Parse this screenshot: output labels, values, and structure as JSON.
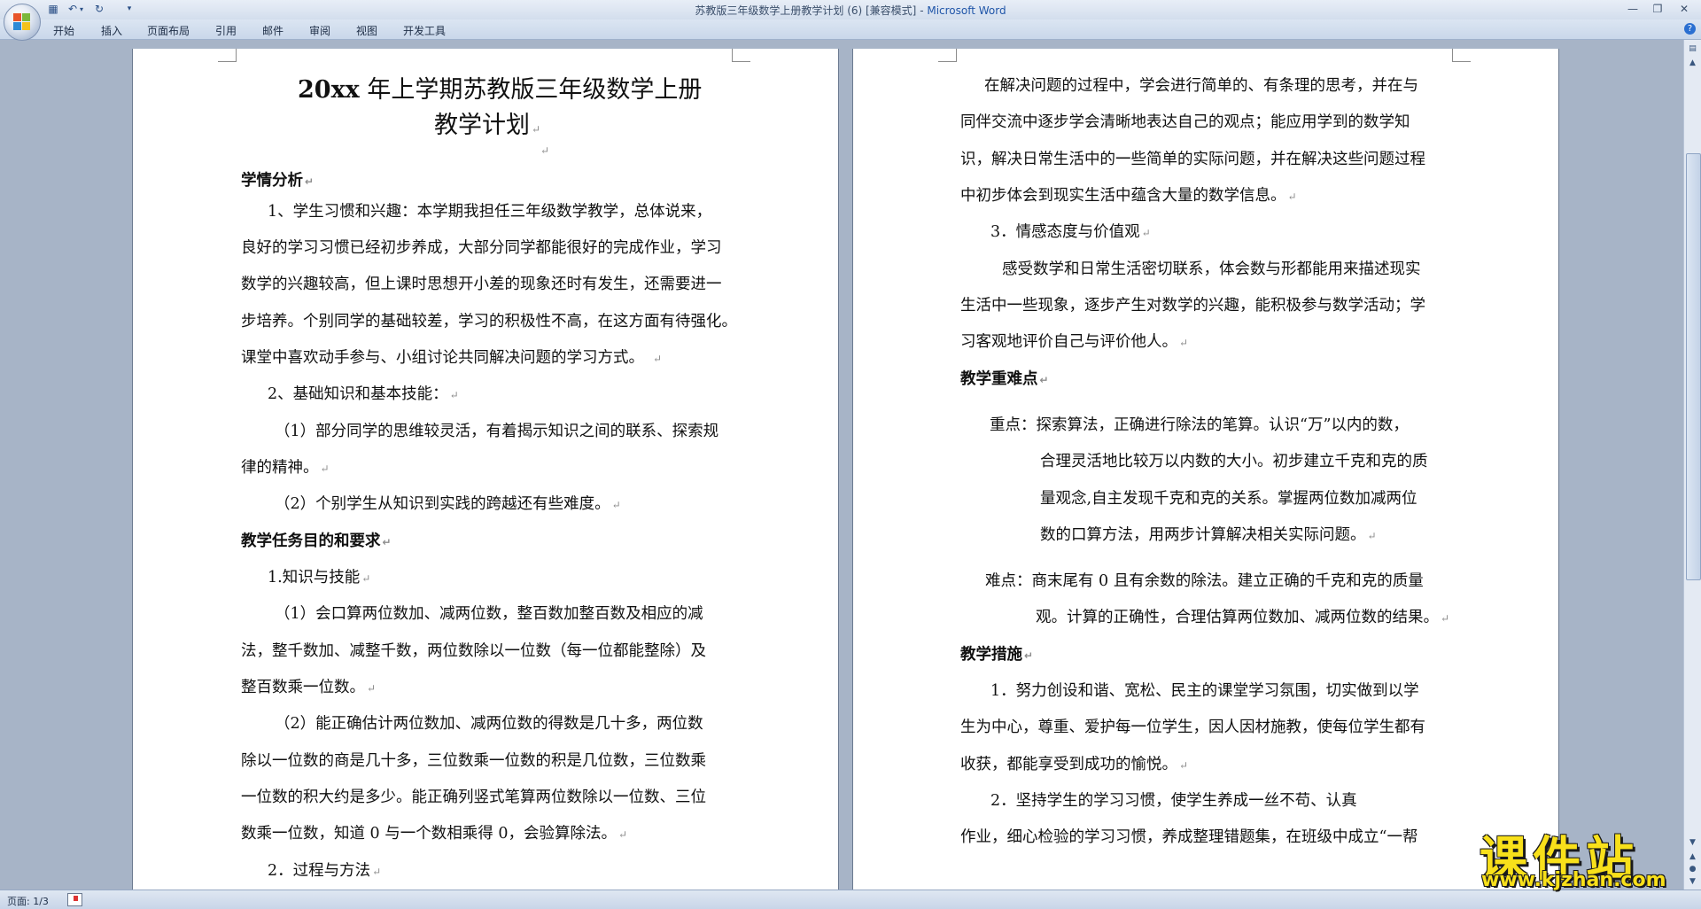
{
  "window": {
    "title": "苏教版三年级数学上册教学计划 (6) [兼容模式]",
    "app_name": "Microsoft Word",
    "sep": " - "
  },
  "qat": {
    "save_icon": "floppy-disk-icon",
    "undo_icon": "undo-icon",
    "redo_icon": "redo-icon",
    "customize_icon": "dropdown-arrow-icon"
  },
  "tabs": [
    "开始",
    "插入",
    "页面布局",
    "引用",
    "邮件",
    "审阅",
    "视图",
    "开发工具"
  ],
  "page1": {
    "title_line1_bold": "20xx",
    "title_line1_rest": " 年上学期苏教版三年级数学上册",
    "title_line2": "教学计划",
    "lines": [
      "学情分析",
      "1、学生习惯和兴趣：本学期我担任三年级数学教学，总体说来，",
      "良好的学习习惯已经初步养成，大部分同学都能很好的完成作业，学习",
      "数学的兴趣较高，但上课时思想开小差的现象还时有发生，还需要进一",
      "步培养。个别同学的基础较差，学习的积极性不高，在这方面有待强化。",
      "课堂中喜欢动手参与、小组讨论共同解决问题的学习方式。",
      "2、基础知识和基本技能：",
      "（1）部分同学的思维较灵活，有着揭示知识之间的联系、探索规",
      "律的精神。",
      "（2）个别学生从知识到实践的跨越还有些难度。",
      "教学任务目的和要求",
      "1.知识与技能",
      "（1）会口算两位数加、减两位数，整百数加整百数及相应的减",
      "法，整千数加、减整千数，两位数除以一位数（每一位都能整除）及",
      "整百数乘一位数。",
      "（2）能正确估计两位数加、减两位数的得数是几十多，两位数",
      "除以一位数的商是几十多，三位数乘一位数的积是几位数，三位数乘",
      "一位数的积大约是多少。能正确列竖式笔算两位数除以一位数、三位",
      "数乘一位数，知道 0 与一个数相乘得 0，会验算除法。",
      "2．过程与方法"
    ]
  },
  "page2": {
    "lines": [
      "在解决问题的过程中，学会进行简单的、有条理的思考，并在与",
      "同伴交流中逐步学会清晰地表达自己的观点；能应用学到的数学知",
      "识，解决日常生活中的一些简单的实际问题，并在解决这些问题过程",
      "中初步体会到现实生活中蕴含大量的数学信息。",
      "3．情感态度与价值观",
      "感受数学和日常生活密切联系，体会数与形都能用来描述现实",
      "生活中一些现象，逐步产生对数学的兴趣，能积极参与数学活动；学",
      "习客观地评价自己与评价他人。",
      "教学重难点",
      "重点：探索算法，正确进行除法的笔算。认识“万”以内的数，",
      "合理灵活地比较万以内数的大小。初步建立千克和克的质",
      "量观念,自主发现千克和克的关系。掌握两位数加减两位",
      "数的口算方法，用两步计算解决相关实际问题。",
      "难点：商末尾有 0 且有余数的除法。建立正确的千克和克的质量",
      "观。计算的正确性，合理估算两位数加、减两位数的结果。",
      "教学措施",
      "1．努力创设和谐、宽松、民主的课堂学习氛围，切实做到以学",
      "生为中心，尊重、爱护每一位学生，因人因材施教，使每位学生都有",
      "收获，都能享受到成功的愉悦。",
      "2．坚持学生的学习习惯，使学生养成一丝不苟、认真",
      "作业，细心检验的学习习惯，养成整理错题集，在班级中成立“一帮"
    ]
  },
  "statusbar": {
    "page_label": "页面: 1/3"
  },
  "watermark": {
    "text": "课件站",
    "url": "www.kjzhan.com"
  },
  "colors": {
    "workspace": "#a7b4c7",
    "watermark_yellow": "#f8e01a",
    "app_blue": "#1f55a8"
  }
}
